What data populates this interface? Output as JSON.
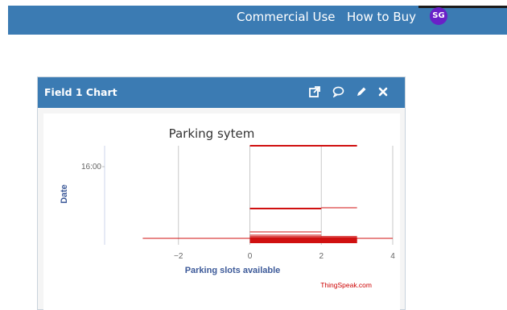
{
  "nav": {
    "commercial_use": "Commercial Use",
    "how_to_buy": "How to Buy",
    "avatar_initials": "SG"
  },
  "card": {
    "title": "Field 1 Chart",
    "icons": [
      "external-link-icon",
      "comment-icon",
      "pencil-icon",
      "close-icon"
    ]
  },
  "chart_data": {
    "type": "scatter",
    "title": "Parking sytem",
    "xlabel": "Parking slots available",
    "ylabel": "Date",
    "xlim": [
      -4,
      4
    ],
    "x_ticks": [
      "−2",
      "0",
      "2",
      "4"
    ],
    "y_ticks": [
      "16:00"
    ],
    "credit": "ThingSpeak.com",
    "colors": {
      "series": "#d01010",
      "grid": "#c8c8c8",
      "axis_text": "#666666",
      "label": "#3d5a99",
      "credit": "#cc0000"
    },
    "series": [
      {
        "segments": [
          {
            "x": [
              0,
              3
            ]
          },
          {
            "x": [
              0,
              2
            ]
          },
          {
            "x": [
              2,
              3
            ]
          },
          {
            "x": [
              0,
              2
            ]
          },
          {
            "x": [
              0,
              2
            ]
          },
          {
            "x": [
              -3,
              4
            ]
          },
          {
            "x": [
              0,
              3
            ]
          },
          {
            "x": [
              0,
              3
            ]
          },
          {
            "x": [
              0,
              3
            ]
          },
          {
            "x": [
              0,
              3
            ]
          },
          {
            "x": [
              0,
              3
            ]
          }
        ]
      }
    ]
  }
}
